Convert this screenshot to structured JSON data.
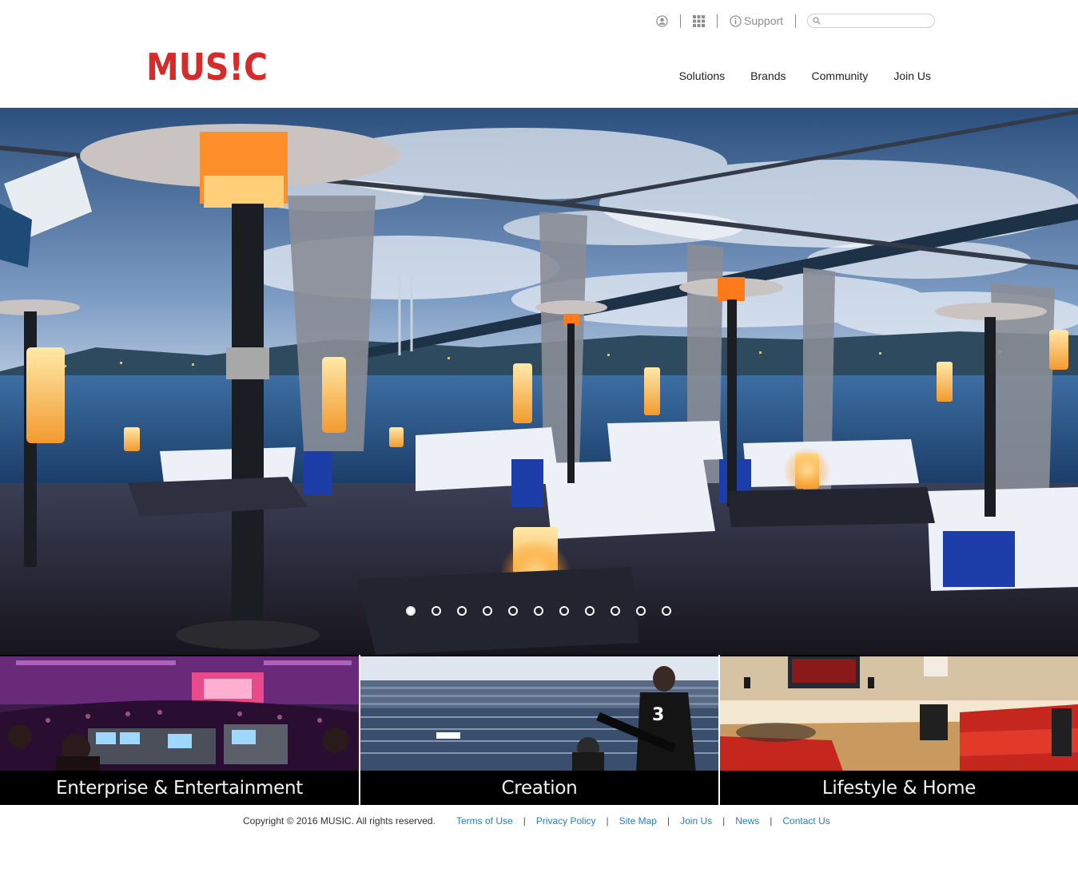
{
  "header": {
    "logo_text": "MUS!C",
    "utility": {
      "account_icon": "user-circle-icon",
      "apps_icon": "grid-icon",
      "support_icon": "info-circle-icon",
      "support_label": "Support",
      "search_placeholder": ""
    },
    "nav": [
      "Solutions",
      "Brands",
      "Community",
      "Join Us"
    ]
  },
  "hero": {
    "slide_count": 11,
    "active_slide": 1
  },
  "tiles": [
    {
      "label": "Enterprise & Entertainment"
    },
    {
      "label": "Creation"
    },
    {
      "label": "Lifestyle & Home"
    }
  ],
  "footer": {
    "copyright": "Copyright © 2016 MUSIC. All rights reserved.",
    "links": [
      "Terms of Use",
      "Privacy Policy",
      "Site Map",
      "Join Us",
      "News",
      "Contact Us"
    ]
  },
  "colors": {
    "brand_red": "#d52b2b",
    "link_blue": "#2a7fb8",
    "caption_bg": "#000000"
  }
}
